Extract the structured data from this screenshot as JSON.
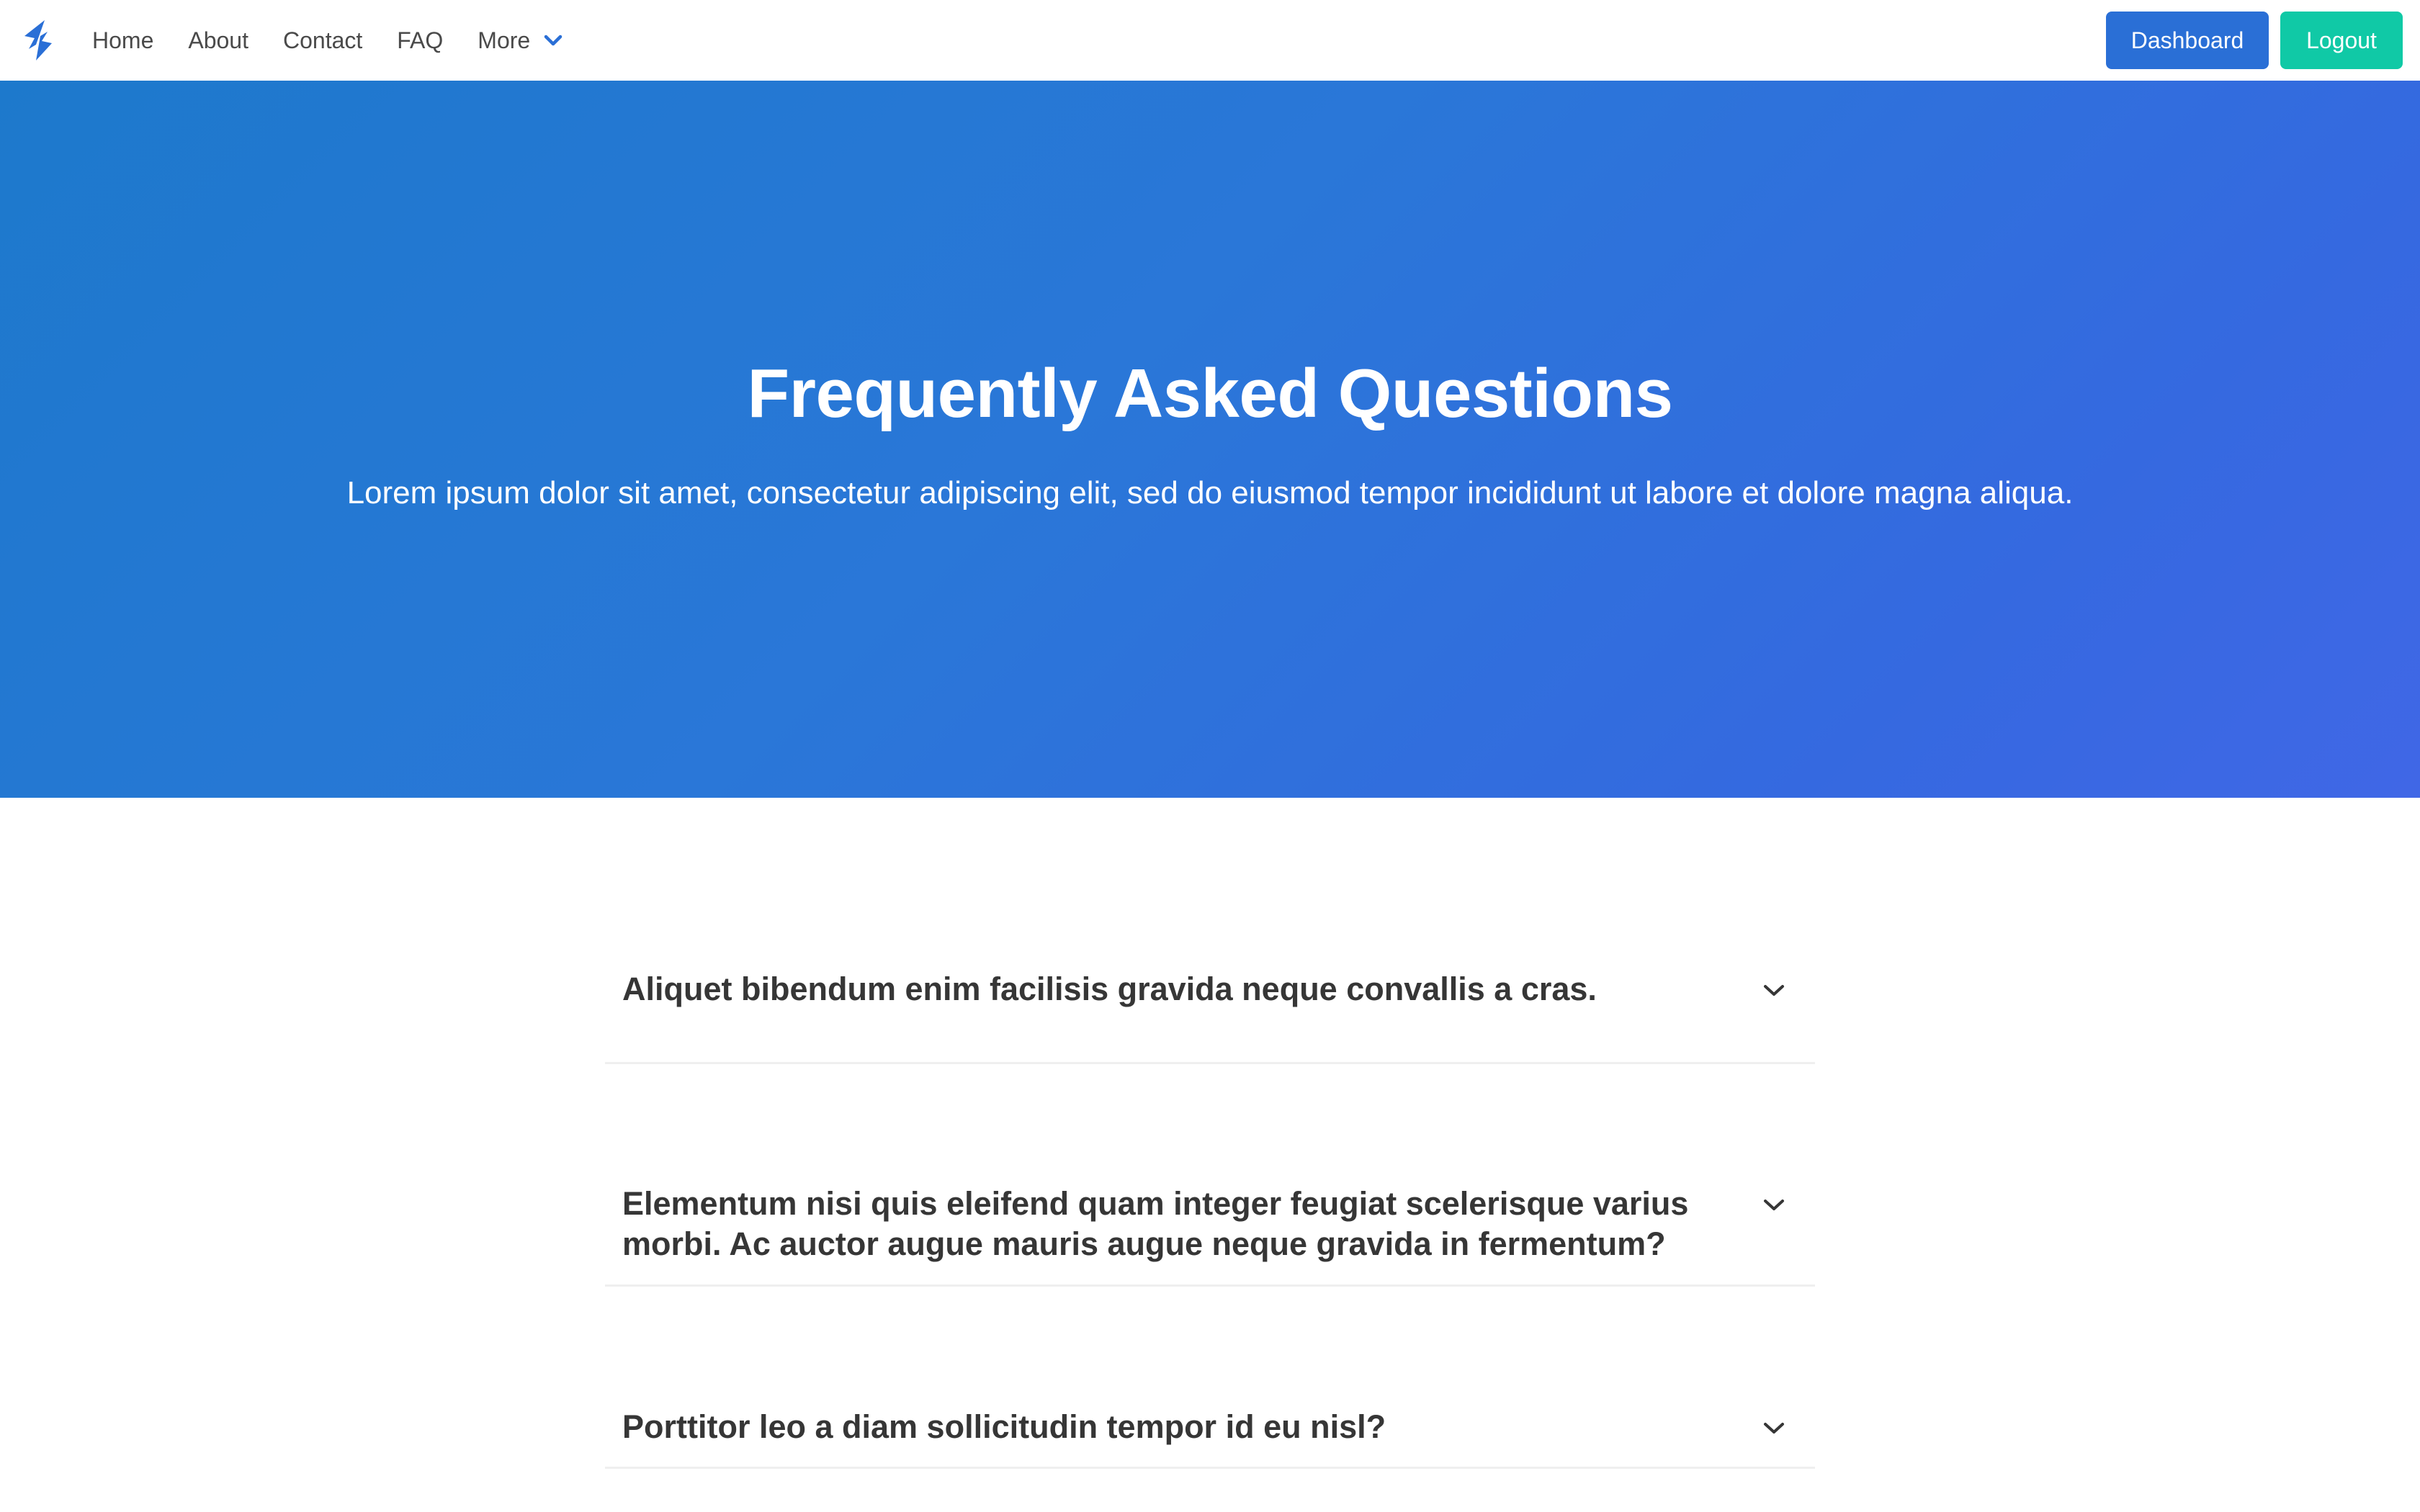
{
  "nav": {
    "logo_icon": "lightning-bolt-icon",
    "links": [
      {
        "label": "Home"
      },
      {
        "label": "About"
      },
      {
        "label": "Contact"
      },
      {
        "label": "FAQ"
      },
      {
        "label": "More",
        "icon": "chevron-down-icon"
      }
    ],
    "actions": {
      "dashboard_label": "Dashboard",
      "logout_label": "Logout"
    }
  },
  "hero": {
    "title": "Frequently Asked Questions",
    "subtitle": "Lorem ipsum dolor sit amet, consectetur adipiscing elit, sed do eiusmod tempor incididunt ut labore et dolore magna aliqua."
  },
  "faq": {
    "items": [
      {
        "question": "Aliquet bibendum enim facilisis gravida neque convallis a cras.",
        "icon": "chevron-down-icon"
      },
      {
        "question": "Elementum nisi quis eleifend quam integer feugiat scelerisque varius morbi. Ac auctor augue mauris augue neque gravida in fermentum?",
        "icon": "chevron-down-icon"
      },
      {
        "question": "Porttitor leo a diam sollicitudin tempor id eu nisl?",
        "icon": "chevron-down-icon"
      }
    ]
  },
  "colors": {
    "primary": "#2a6fd6",
    "accent": "#10c9a6",
    "hero_gradient_start": "#1d79cc",
    "hero_gradient_end": "#4067e6",
    "text_dark": "#363636"
  }
}
